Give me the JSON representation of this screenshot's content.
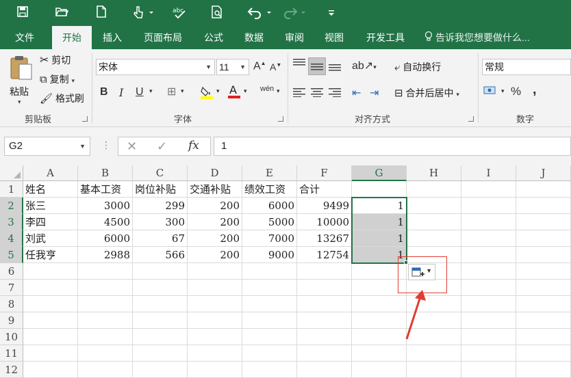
{
  "tabs": [
    "文件",
    "开始",
    "插入",
    "页面布局",
    "公式",
    "数据",
    "审阅",
    "视图",
    "开发工具"
  ],
  "active_tab": "开始",
  "tell_me": "告诉我您想要做什么...",
  "clipboard": {
    "paste": "粘贴",
    "cut": "剪切",
    "copy": "复制",
    "format_painter": "格式刷",
    "group": "剪贴板"
  },
  "font": {
    "name": "宋体",
    "size": "11",
    "group": "字体",
    "bold": "B",
    "italic": "I",
    "underline": "U"
  },
  "alignment": {
    "wrap": "自动换行",
    "merge": "合并后居中",
    "group": "对齐方式"
  },
  "number": {
    "format": "常规",
    "group": "数字",
    "percent": "%",
    "comma": ","
  },
  "name_box": "G2",
  "formula_value": "1",
  "columns": [
    "A",
    "B",
    "C",
    "D",
    "E",
    "F",
    "G",
    "H",
    "I",
    "J"
  ],
  "rows": [
    "1",
    "2",
    "3",
    "4",
    "5",
    "6",
    "7",
    "8",
    "9",
    "10",
    "11",
    "12"
  ],
  "table": {
    "header": [
      "姓名",
      "基本工资",
      "岗位补贴",
      "交通补贴",
      "绩效工资",
      "合计"
    ],
    "data": [
      [
        "张三",
        "3000",
        "299",
        "200",
        "6000",
        "9499",
        "1"
      ],
      [
        "李四",
        "4500",
        "300",
        "200",
        "5000",
        "10000",
        "1"
      ],
      [
        "刘武",
        "6000",
        "67",
        "200",
        "7000",
        "13267",
        "1"
      ],
      [
        "任我亨",
        "2988",
        "566",
        "200",
        "9000",
        "12754",
        "1"
      ]
    ]
  },
  "colors": {
    "accent": "#217346",
    "annotation": "#e03c31"
  },
  "icons": [
    "save-icon",
    "open-icon",
    "new-icon",
    "touch-mode-icon",
    "spelling-icon",
    "print-preview-icon",
    "undo-icon",
    "redo-icon",
    "lightbulb-icon",
    "paste-options-icon"
  ]
}
